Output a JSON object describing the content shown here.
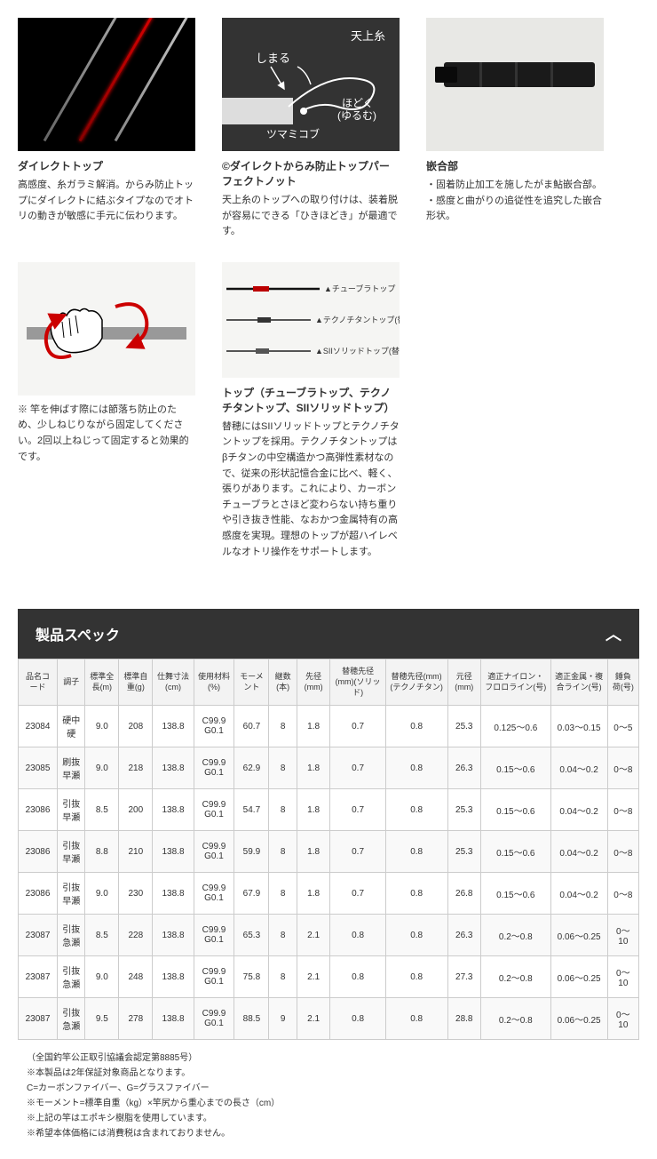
{
  "features": [
    {
      "title": "ダイレクトトップ",
      "desc": "高感度、糸ガラミ解消。からみ防止トップにダイレクトに結ぶタイプなのでオトリの動きが敏感に手元に伝わります。"
    },
    {
      "title": "©ダイレクトからみ防止トップパーフェクトノット",
      "desc": "天上糸のトップへの取り付けは、装着脱が容易にできる「ひきほどき」が最適です。",
      "labels": {
        "top": "天上糸",
        "close": "しまる",
        "open": "ほどく\n(ゆるむ)",
        "knob": "ツマミコブ"
      }
    },
    {
      "title": "嵌合部",
      "desc_list": [
        "・固着防止加工を施したがま鮎嵌合部。",
        "・感度と曲がりの追従性を追究した嵌合形状。"
      ]
    },
    {
      "title": "",
      "desc": "※ 竿を伸ばす際には節落ち防止のため、少しねじりながら固定してください。2回以上ねじって固定すると効果的です。"
    },
    {
      "title": "トップ（チューブラトップ、テクノチタントップ、SIIソリッドトップ）",
      "desc": "替穂にはSIIソリッドトップとテクノチタントップを採用。テクノチタントップはβチタンの中空構造かつ高弾性素材なので、従来の形状記憶合金に比べ、軽く、張りがあります。これにより、カーボンチューブラとさほど変わらない持ち重りや引き抜き性能、なおかつ金属特有の高感度を実現。理想のトップが超ハイレベルなオトリ操作をサポートします。",
      "labels": {
        "a": "▲チューブラトップ",
        "b": "▲テクノチタントップ(替穂)",
        "c": "▲SIIソリッドトップ(替穂)"
      }
    }
  ],
  "spec_title": "製品スペック",
  "headers": [
    "品名コード",
    "調子",
    "標準全長(m)",
    "標準自重(g)",
    "仕舞寸法(cm)",
    "使用材料(%)",
    "モーメント",
    "継数(本)",
    "先径(mm)",
    "替穂先径(mm)(ソリッド)",
    "替穂先径(mm)(テクノチタン)",
    "元径(mm)",
    "適正ナイロン・フロロライン(号)",
    "適正金属・複合ライン(号)",
    "錘負荷(号)"
  ],
  "rows": [
    [
      "23084",
      "硬中硬",
      "9.0",
      "208",
      "138.8",
      "C99.9 G0.1",
      "60.7",
      "8",
      "1.8",
      "0.7",
      "0.8",
      "25.3",
      "0.125～0.6",
      "0.03～0.15",
      "0～5"
    ],
    [
      "23085",
      "刷抜早瀬",
      "9.0",
      "218",
      "138.8",
      "C99.9 G0.1",
      "62.9",
      "8",
      "1.8",
      "0.7",
      "0.8",
      "26.3",
      "0.15～0.6",
      "0.04～0.2",
      "0～8"
    ],
    [
      "23086",
      "引抜早瀬",
      "8.5",
      "200",
      "138.8",
      "C99.9 G0.1",
      "54.7",
      "8",
      "1.8",
      "0.7",
      "0.8",
      "25.3",
      "0.15～0.6",
      "0.04～0.2",
      "0～8"
    ],
    [
      "23086",
      "引抜早瀬",
      "8.8",
      "210",
      "138.8",
      "C99.9 G0.1",
      "59.9",
      "8",
      "1.8",
      "0.7",
      "0.8",
      "25.3",
      "0.15～0.6",
      "0.04～0.2",
      "0～8"
    ],
    [
      "23086",
      "引抜早瀬",
      "9.0",
      "230",
      "138.8",
      "C99.9 G0.1",
      "67.9",
      "8",
      "1.8",
      "0.7",
      "0.8",
      "26.8",
      "0.15～0.6",
      "0.04～0.2",
      "0～8"
    ],
    [
      "23087",
      "引抜急瀬",
      "8.5",
      "228",
      "138.8",
      "C99.9 G0.1",
      "65.3",
      "8",
      "2.1",
      "0.8",
      "0.8",
      "26.3",
      "0.2～0.8",
      "0.06～0.25",
      "0～10"
    ],
    [
      "23087",
      "引抜急瀬",
      "9.0",
      "248",
      "138.8",
      "C99.9 G0.1",
      "75.8",
      "8",
      "2.1",
      "0.8",
      "0.8",
      "27.3",
      "0.2～0.8",
      "0.06～0.25",
      "0～10"
    ],
    [
      "23087",
      "引抜急瀬",
      "9.5",
      "278",
      "138.8",
      "C99.9 G0.1",
      "88.5",
      "9",
      "2.1",
      "0.8",
      "0.8",
      "28.8",
      "0.2～0.8",
      "0.06～0.25",
      "0～10"
    ]
  ],
  "notes": [
    "（全国釣竿公正取引協議会認定第8885号）",
    "※本製品は2年保証対象商品となります。",
    "C=カーボンファイバー、G=グラスファイバー",
    "※モーメント=標準自重（kg）×竿尻から重心までの長さ（cm）",
    "※上記の竿はエポキシ樹脂を使用しています。",
    "※希望本体価格には消費税は含まれておりません。"
  ]
}
